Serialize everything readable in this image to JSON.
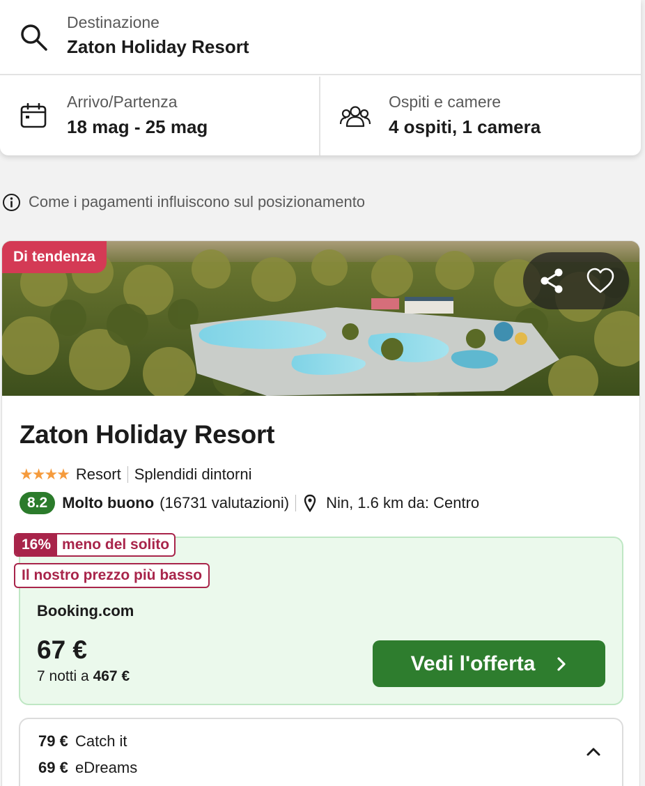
{
  "search": {
    "destination_label": "Destinazione",
    "destination_value": "Zaton Holiday Resort",
    "dates_label": "Arrivo/Partenza",
    "dates_value": "18 mag - 25 mag",
    "guests_label": "Ospiti e camere",
    "guests_value": "4 ospiti, 1 camera"
  },
  "info": {
    "text": "Come i pagamenti influiscono sul posizionamento"
  },
  "hotel": {
    "badge": "Di tendenza",
    "name": "Zaton Holiday Resort",
    "stars": "★★★★",
    "star_count": 4,
    "type": "Resort",
    "feature": "Splendidi dintorni",
    "score": "8.2",
    "rating_word": "Molto buono",
    "reviews": "(16731 valutazioni)",
    "location": "Nin, 1.6 km da: Centro"
  },
  "offer": {
    "discount_pct": "16%",
    "discount_label": "meno del solito",
    "lowest_label": "Il nostro prezzo più basso",
    "provider": "Booking.com",
    "price": "67 €",
    "total_prefix": "7 notti a",
    "total_value": "467 €",
    "cta_label": "Vedi l'offerta"
  },
  "alternatives": [
    {
      "price": "79 €",
      "provider": "Catch it"
    },
    {
      "price": "69 €",
      "provider": "eDreams"
    }
  ],
  "colors": {
    "badge_red": "#d43a55",
    "score_green": "#2b7b2b",
    "cta_green": "#2e7d2e",
    "deal_red": "#a8244a",
    "offer_bg": "#ebf9ec",
    "star_orange": "#f59b3d"
  }
}
